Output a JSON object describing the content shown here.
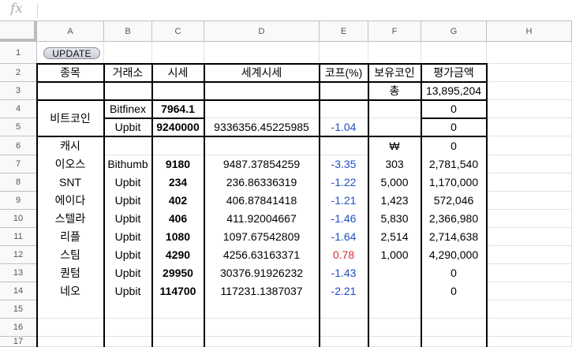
{
  "formula_bar": {
    "fx_label": "fx",
    "value": ""
  },
  "columns": [
    "A",
    "B",
    "C",
    "D",
    "E",
    "F",
    "G",
    "H"
  ],
  "rows": [
    "1",
    "2",
    "3",
    "4",
    "5",
    "6",
    "7",
    "8",
    "9",
    "10",
    "11",
    "12",
    "13",
    "14",
    "15",
    "16",
    "17"
  ],
  "update_button": "UPDATE",
  "headers": {
    "name": "종목",
    "exchange": "거래소",
    "price": "시세",
    "world_price": "세계시세",
    "premium": "코프(%)",
    "holding": "보유코인",
    "value": "평가금액"
  },
  "total": {
    "label": "총",
    "value": "13,895,204"
  },
  "bitcoin": {
    "name": "비트코인",
    "bitfinex": {
      "exchange": "Bitfinex",
      "price": "7964.1",
      "value": "0"
    },
    "upbit": {
      "exchange": "Upbit",
      "price": "9240000",
      "world_price": "9336356.45225985",
      "premium": "-1.04",
      "value": "0"
    }
  },
  "cash": {
    "name": "캐시",
    "holding": "₩",
    "value": "0"
  },
  "coins": [
    {
      "name": "이오스",
      "exchange": "Bithumb",
      "price": "9180",
      "world_price": "9487.37854259",
      "premium": "-3.35",
      "holding": "303",
      "value": "2,781,540",
      "premium_color": "blue"
    },
    {
      "name": "SNT",
      "exchange": "Upbit",
      "price": "234",
      "world_price": "236.86336319",
      "premium": "-1.22",
      "holding": "5,000",
      "value": "1,170,000",
      "premium_color": "blue"
    },
    {
      "name": "에이다",
      "exchange": "Upbit",
      "price": "402",
      "world_price": "406.87841418",
      "premium": "-1.21",
      "holding": "1,423",
      "value": "572,046",
      "premium_color": "blue"
    },
    {
      "name": "스텔라",
      "exchange": "Upbit",
      "price": "406",
      "world_price": "411.92004667",
      "premium": "-1.46",
      "holding": "5,830",
      "value": "2,366,980",
      "premium_color": "blue"
    },
    {
      "name": "리플",
      "exchange": "Upbit",
      "price": "1080",
      "world_price": "1097.67542809",
      "premium": "-1.64",
      "holding": "2,514",
      "value": "2,714,638",
      "premium_color": "blue"
    },
    {
      "name": "스팀",
      "exchange": "Upbit",
      "price": "4290",
      "world_price": "4256.63163371",
      "premium": "0.78",
      "holding": "1,000",
      "value": "4,290,000",
      "premium_color": "red"
    },
    {
      "name": "퀀텀",
      "exchange": "Upbit",
      "price": "29950",
      "world_price": "30376.91926232",
      "premium": "-1.43",
      "holding": "",
      "value": "0",
      "premium_color": "blue"
    },
    {
      "name": "네오",
      "exchange": "Upbit",
      "price": "114700",
      "world_price": "117231.1387037",
      "premium": "-2.21",
      "holding": "",
      "value": "0",
      "premium_color": "blue"
    }
  ],
  "colors": {
    "negative": "#1f4fbf",
    "positive": "#e0282e",
    "header_bg": "#f8f9fa"
  }
}
